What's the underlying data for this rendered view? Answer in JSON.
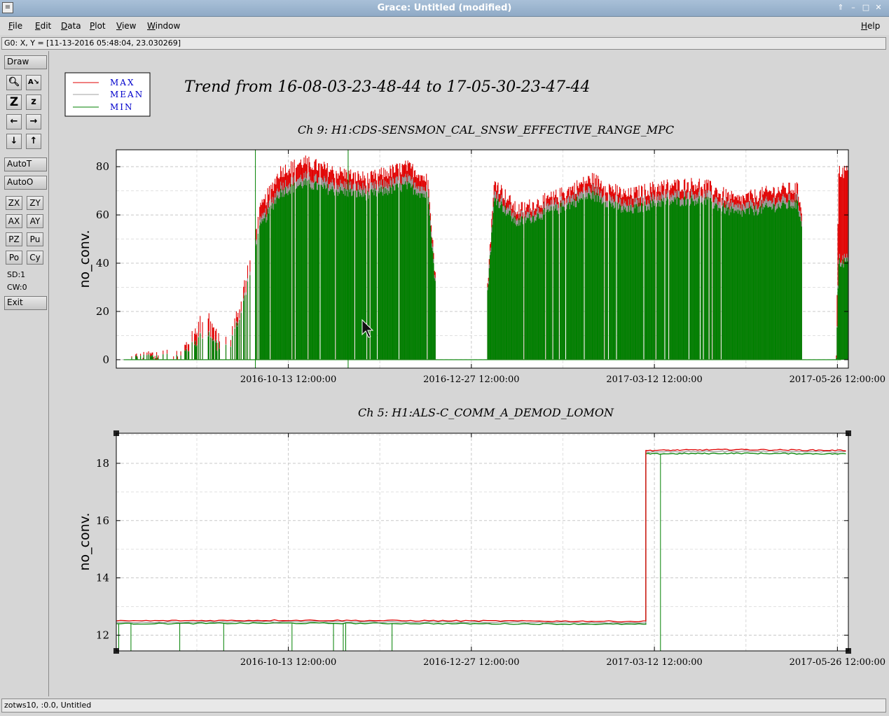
{
  "window": {
    "title": "Grace: Untitled (modified)"
  },
  "menu": [
    {
      "label": "File",
      "key": "F",
      "rest": "ile"
    },
    {
      "label": "Edit",
      "key": "E",
      "rest": "dit"
    },
    {
      "label": "Data",
      "key": "D",
      "rest": "ata"
    },
    {
      "label": "Plot",
      "key": "P",
      "rest": "lot"
    },
    {
      "label": "View",
      "key": "V",
      "rest": "iew"
    },
    {
      "label": "Window",
      "key": "W",
      "rest": "indow"
    }
  ],
  "help_menu": {
    "label": "Help",
    "key": "H",
    "rest": "elp"
  },
  "locator": "G0: X, Y = [11-13-2016 05:48:04, 23.030269]",
  "toolbar": {
    "draw": "Draw",
    "autot": "AutoT",
    "autoo": "AutoO",
    "zx": "ZX",
    "zy": "ZY",
    "ax": "AX",
    "ay": "AY",
    "pz": "PZ",
    "pu": "Pu",
    "po": "Po",
    "cy": "Cy",
    "sd": "SD:1",
    "cw": "CW:0",
    "exit": "Exit"
  },
  "status": "zotws10, :0.0, Untitled",
  "plot": {
    "title": "Trend from 16-08-03-23-48-44 to 17-05-30-23-47-44",
    "legend": [
      {
        "name": "MAX",
        "color": "#e00000"
      },
      {
        "name": "MEAN",
        "color": "#a0a0a0"
      },
      {
        "name": "MIN",
        "color": "#008000"
      }
    ],
    "label_color": "#0000cc"
  },
  "chart_data": [
    {
      "type": "line",
      "title": "Ch 9: H1:CDS-SENSMON_CAL_SNSW_EFFECTIVE_RANGE_MPC",
      "ylabel": "no_conv.",
      "xlabel": "",
      "x_range": [
        "2016-08-03 23:48:44",
        "2017-05-30 23:47:44"
      ],
      "ylim": [
        -3.5,
        87
      ],
      "yticks": [
        0,
        20,
        40,
        60,
        80
      ],
      "xticks": [
        "2016-10-13 12:00:00",
        "2016-12-27 12:00:00",
        "2017-03-12 12:00:00",
        "2017-05-26 12:00:00"
      ],
      "grid": true,
      "series": [
        {
          "name": "MAX",
          "x": [
            "2016-08-07",
            "2016-08-20",
            "2016-09-01",
            "2016-09-10",
            "2016-09-15",
            "2016-09-20",
            "2016-09-26",
            "2016-10-01",
            "2016-10-10",
            "2016-10-20",
            "2016-11-01",
            "2016-11-15",
            "2016-12-01",
            "2016-12-05",
            "2016-12-10",
            "2016-12-15",
            "2017-01-01",
            "2017-01-06",
            "2017-01-15",
            "2017-02-01",
            "2017-02-15",
            "2017-03-01",
            "2017-03-15",
            "2017-04-01",
            "2017-04-15",
            "2017-05-01",
            "2017-05-10",
            "2017-05-26",
            "2017-05-27"
          ],
          "values": [
            0,
            2,
            5,
            20,
            8,
            10,
            33,
            60,
            78,
            82,
            78,
            75,
            80,
            78,
            74,
            0,
            0,
            74,
            62,
            68,
            75,
            68,
            72,
            73,
            66,
            70,
            71,
            0,
            78
          ]
        },
        {
          "name": "MEAN",
          "x": [
            "2016-08-07",
            "2016-08-20",
            "2016-09-01",
            "2016-09-10",
            "2016-09-15",
            "2016-09-20",
            "2016-09-26",
            "2016-10-01",
            "2016-10-10",
            "2016-10-20",
            "2016-11-01",
            "2016-11-15",
            "2016-12-01",
            "2016-12-05",
            "2016-12-10",
            "2016-12-15",
            "2017-01-01",
            "2017-01-06",
            "2017-01-15",
            "2017-02-01",
            "2017-02-15",
            "2017-03-01",
            "2017-03-15",
            "2017-04-01",
            "2017-04-15",
            "2017-05-01",
            "2017-05-10",
            "2017-05-26",
            "2017-05-27"
          ],
          "values": [
            0,
            1,
            3,
            12,
            5,
            7,
            28,
            55,
            72,
            76,
            73,
            71,
            75,
            73,
            70,
            0,
            0,
            70,
            59,
            65,
            71,
            64,
            68,
            69,
            63,
            66,
            67,
            0,
            42
          ]
        },
        {
          "name": "MIN",
          "x": [
            "2016-08-07",
            "2016-08-20",
            "2016-09-01",
            "2016-09-10",
            "2016-09-15",
            "2016-09-20",
            "2016-09-26",
            "2016-10-01",
            "2016-10-10",
            "2016-10-20",
            "2016-11-01",
            "2016-11-15",
            "2016-12-01",
            "2016-12-05",
            "2016-12-10",
            "2016-12-15",
            "2017-01-01",
            "2017-01-06",
            "2017-01-15",
            "2017-02-01",
            "2017-02-15",
            "2017-03-01",
            "2017-03-15",
            "2017-04-01",
            "2017-04-15",
            "2017-05-01",
            "2017-05-10",
            "2017-05-26",
            "2017-05-27"
          ],
          "values": [
            0,
            0,
            0,
            0,
            0,
            0,
            0,
            0,
            0,
            0,
            0,
            0,
            0,
            0,
            0,
            0,
            0,
            0,
            0,
            0,
            0,
            0,
            0,
            0,
            0,
            0,
            0,
            0,
            0
          ]
        }
      ]
    },
    {
      "type": "line",
      "title": "Ch 5: H1:ALS-C_COMM_A_DEMOD_LOMON",
      "ylabel": "no_conv.",
      "xlabel": "",
      "x_range": [
        "2016-08-03 23:48:44",
        "2017-05-30 23:47:44"
      ],
      "ylim": [
        11.45,
        19.05
      ],
      "yticks": [
        12,
        14,
        16,
        18
      ],
      "xticks": [
        "2016-10-13 12:00:00",
        "2016-12-27 12:00:00",
        "2017-03-12 12:00:00",
        "2017-05-26 12:00:00"
      ],
      "grid": true,
      "series": [
        {
          "name": "MAX",
          "x": [
            "2016-08-04",
            "2016-10-13",
            "2016-12-27",
            "2017-03-08",
            "2017-03-09",
            "2017-04-15",
            "2017-05-30"
          ],
          "values": [
            12.5,
            12.52,
            12.5,
            12.48,
            18.45,
            18.48,
            18.45
          ]
        },
        {
          "name": "MEAN",
          "x": [
            "2016-08-04",
            "2016-10-13",
            "2016-12-27",
            "2017-03-08",
            "2017-03-09",
            "2017-04-15",
            "2017-05-30"
          ],
          "values": [
            12.45,
            12.47,
            12.45,
            12.43,
            18.4,
            18.42,
            18.4
          ]
        },
        {
          "name": "MIN",
          "x": [
            "2016-08-04",
            "2016-10-13",
            "2016-12-27",
            "2017-03-08",
            "2017-03-09",
            "2017-04-15",
            "2017-05-30"
          ],
          "values": [
            12.4,
            12.42,
            12.4,
            12.38,
            18.33,
            18.35,
            18.33
          ]
        }
      ]
    }
  ]
}
